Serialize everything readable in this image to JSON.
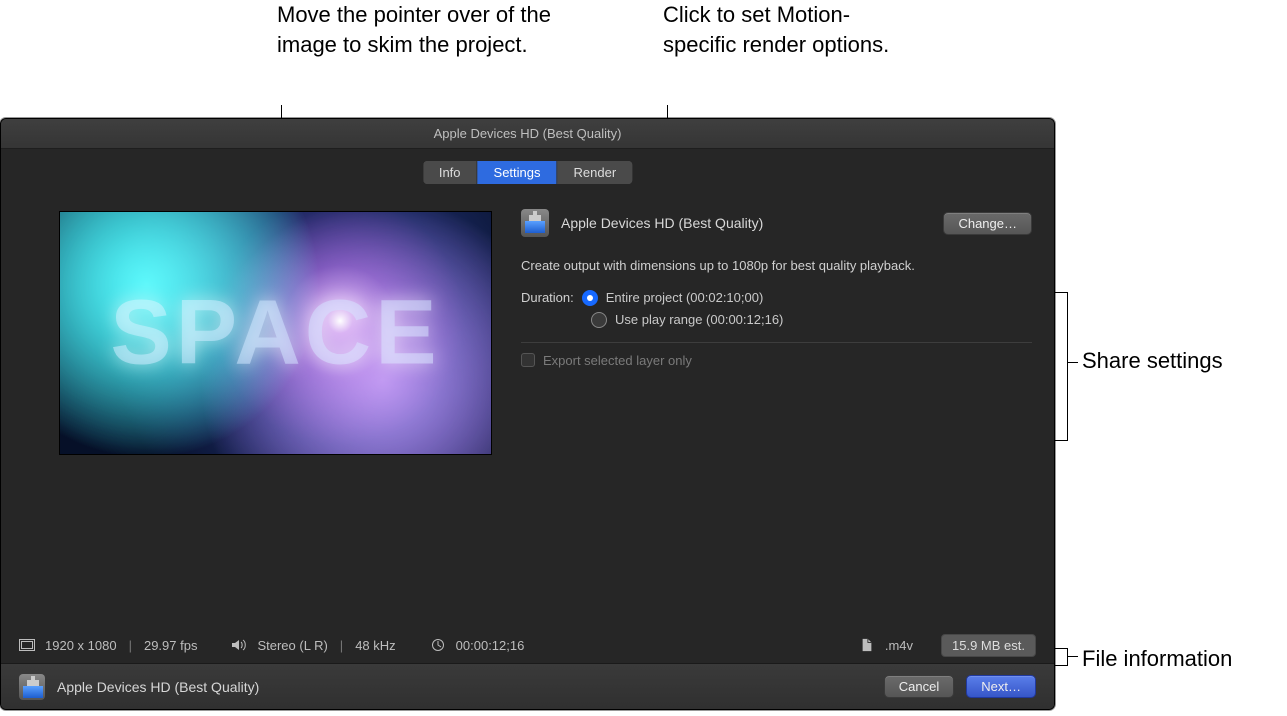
{
  "callouts": {
    "skim": "Move the pointer over of the image to skim the project.",
    "render": "Click to set Motion-specific render options.",
    "share": "Share settings",
    "fileinfo": "File information"
  },
  "window": {
    "title": "Apple Devices HD (Best Quality)"
  },
  "tabs": {
    "info": "Info",
    "settings": "Settings",
    "render": "Render",
    "active": "Settings"
  },
  "preview": {
    "text": "SPACE"
  },
  "panel": {
    "preset_name": "Apple Devices HD (Best Quality)",
    "change_label": "Change…",
    "description": "Create output with dimensions up to 1080p for best quality playback.",
    "duration_label": "Duration:",
    "option_entire": "Entire project (00:02:10;00)",
    "option_playrange": "Use play range (00:00:12;16)",
    "export_layer_label": "Export selected layer only"
  },
  "status": {
    "dimensions": "1920 x 1080",
    "fps": "29.97 fps",
    "audio": "Stereo (L R)",
    "sample_rate": "48 kHz",
    "duration": "00:00:12;16",
    "extension": ".m4v",
    "size_estimate": "15.9 MB est."
  },
  "footer": {
    "preset_name": "Apple Devices HD (Best Quality)",
    "cancel": "Cancel",
    "next": "Next…"
  }
}
